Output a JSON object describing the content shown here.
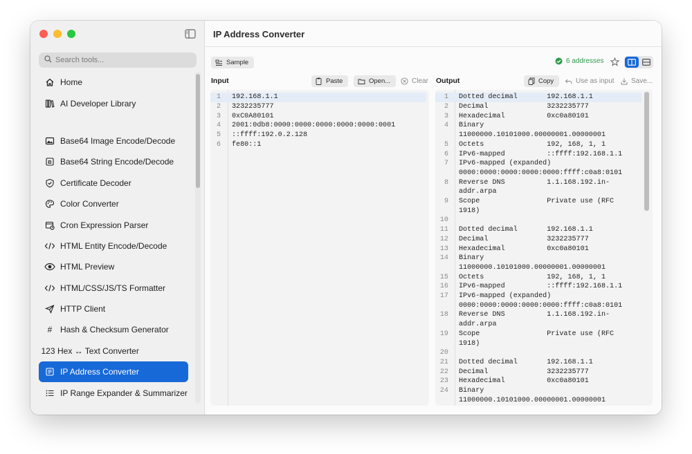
{
  "app": {
    "title": "IP Address Converter"
  },
  "sidebar": {
    "search_placeholder": "Search tools...",
    "items": [
      {
        "label": "Home",
        "icon": "home-icon"
      },
      {
        "label": "AI Developer Library",
        "icon": "library-icon"
      },
      {
        "label": "Base64 Image Encode/Decode",
        "icon": "image-icon"
      },
      {
        "label": "Base64 String Encode/Decode",
        "icon": "b-box-icon"
      },
      {
        "label": "Certificate Decoder",
        "icon": "shield-check-icon"
      },
      {
        "label": "Color Converter",
        "icon": "palette-icon"
      },
      {
        "label": "Cron Expression Parser",
        "icon": "calendar-clock-icon"
      },
      {
        "label": "HTML Entity Encode/Decode",
        "icon": "code-icon"
      },
      {
        "label": "HTML Preview",
        "icon": "eye-icon"
      },
      {
        "label": "HTML/CSS/JS/TS Formatter",
        "icon": "code-icon"
      },
      {
        "label": "HTTP Client",
        "icon": "send-icon"
      },
      {
        "label": "Hash & Checksum Generator",
        "icon": "hash-icon"
      },
      {
        "label": "Hex ↔ Text Converter",
        "icon": "123-icon",
        "icon_text": "123"
      },
      {
        "label": "IP Address Converter",
        "icon": "network-icon",
        "active": true
      },
      {
        "label": "IP Range Expander & Summarizer",
        "icon": "list-icon"
      }
    ]
  },
  "toolbar": {
    "sample_label": "Sample",
    "status_text": "6 addresses"
  },
  "input": {
    "label": "Input",
    "paste_label": "Paste",
    "open_label": "Open...",
    "clear_label": "Clear",
    "lines": [
      "192.168.1.1",
      "3232235777",
      "0xC0A80101",
      "2001:0db8:0000:0000:0000:0000:0000:0001",
      "::ffff:192.0.2.128",
      "fe80::1"
    ]
  },
  "output": {
    "label": "Output",
    "copy_label": "Copy",
    "use_as_input_label": "Use as input",
    "save_label": "Save...",
    "rows": [
      {
        "n": "1",
        "text": "Dotted decimal       192.168.1.1"
      },
      {
        "n": "2",
        "text": "Decimal              3232235777"
      },
      {
        "n": "3",
        "text": "Hexadecimal          0xc0a80101"
      },
      {
        "n": "4",
        "text": "Binary"
      },
      {
        "n": "",
        "text": "11000000.10101000.00000001.00000001"
      },
      {
        "n": "5",
        "text": "Octets               192, 168, 1, 1"
      },
      {
        "n": "6",
        "text": "IPv6-mapped          ::ffff:192.168.1.1"
      },
      {
        "n": "7",
        "text": "IPv6-mapped (expanded)"
      },
      {
        "n": "",
        "text": "0000:0000:0000:0000:0000:ffff:c0a8:0101"
      },
      {
        "n": "8",
        "text": "Reverse DNS          1.1.168.192.in-"
      },
      {
        "n": "",
        "text": "addr.arpa"
      },
      {
        "n": "9",
        "text": "Scope                Private use (RFC"
      },
      {
        "n": "",
        "text": "1918)"
      },
      {
        "n": "10",
        "text": ""
      },
      {
        "n": "11",
        "text": "Dotted decimal       192.168.1.1"
      },
      {
        "n": "12",
        "text": "Decimal              3232235777"
      },
      {
        "n": "13",
        "text": "Hexadecimal          0xc0a80101"
      },
      {
        "n": "14",
        "text": "Binary"
      },
      {
        "n": "",
        "text": "11000000.10101000.00000001.00000001"
      },
      {
        "n": "15",
        "text": "Octets               192, 168, 1, 1"
      },
      {
        "n": "16",
        "text": "IPv6-mapped          ::ffff:192.168.1.1"
      },
      {
        "n": "17",
        "text": "IPv6-mapped (expanded)"
      },
      {
        "n": "",
        "text": "0000:0000:0000:0000:0000:ffff:c0a8:0101"
      },
      {
        "n": "18",
        "text": "Reverse DNS          1.1.168.192.in-"
      },
      {
        "n": "",
        "text": "addr.arpa"
      },
      {
        "n": "19",
        "text": "Scope                Private use (RFC"
      },
      {
        "n": "",
        "text": "1918)"
      },
      {
        "n": "20",
        "text": ""
      },
      {
        "n": "21",
        "text": "Dotted decimal       192.168.1.1"
      },
      {
        "n": "22",
        "text": "Decimal              3232235777"
      },
      {
        "n": "23",
        "text": "Hexadecimal          0xc0a80101"
      },
      {
        "n": "24",
        "text": "Binary"
      },
      {
        "n": "",
        "text": "11000000.10101000.00000001.00000001"
      }
    ]
  },
  "colors": {
    "accent": "#1769d8",
    "status_green": "#2f9a4b"
  }
}
